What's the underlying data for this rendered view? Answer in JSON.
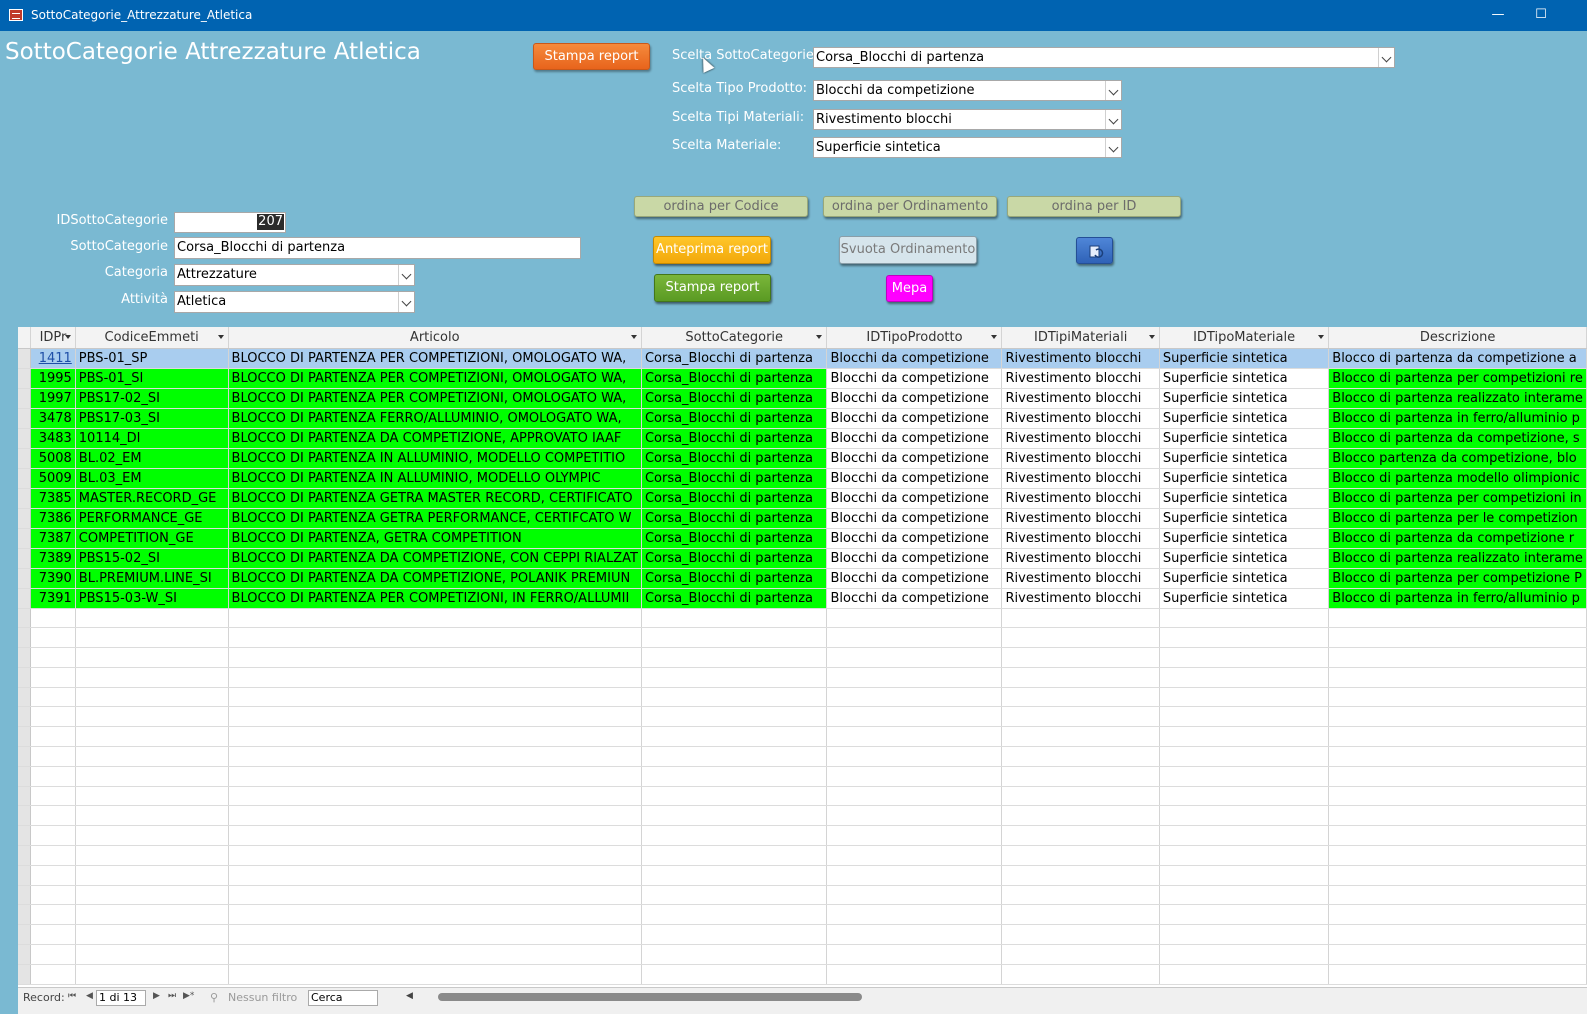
{
  "window": {
    "title": "SottoCategorie_Attrezzature_Atletica",
    "minimize": "—",
    "maximize": "☐"
  },
  "form_title": "SottoCategorie Attrezzature Atletica",
  "buttons": {
    "stampa_report_top": "Stampa report",
    "ordina_codice": "ordina per Codice",
    "ordina_ordinamento": "ordina per Ordinamento",
    "ordina_id": "ordina per ID",
    "anteprima_report": "Anteprima report",
    "svuota_ordinamento": "Svuota Ordinamento",
    "stampa_report": "Stampa report",
    "mepa": "Mepa"
  },
  "filters": {
    "sottocategorie_label": "Scelta SottoCategorie:",
    "sottocategorie_value": "Corsa_Blocchi di partenza",
    "tipo_prodotto_label": "Scelta Tipo Prodotto:",
    "tipo_prodotto_value": "Blocchi da competizione",
    "tipi_materiali_label": "Scelta Tipi Materiali:",
    "tipi_materiali_value": "Rivestimento blocchi",
    "materiale_label": "Scelta Materiale:",
    "materiale_value": "Superficie sintetica"
  },
  "record": {
    "id_label": "IDSottoCategorie",
    "id_value": "207",
    "sotto_label": "SottoCategorie",
    "sotto_value": "Corsa_Blocchi di partenza",
    "categoria_label": "Categoria",
    "categoria_value": "Attrezzature",
    "attivita_label": "Attività",
    "attivita_value": "Atletica"
  },
  "grid": {
    "columns": [
      "IDPr",
      "CodiceEmmeti",
      "Articolo",
      "SottoCategorie",
      "IDTipoProdotto",
      "IDTipiMateriali",
      "IDTipoMateriale",
      "Descrizione"
    ],
    "rows": [
      [
        "1411",
        "PBS-01_SP",
        "BLOCCO DI PARTENZA PER COMPETIZIONI, OMOLOGATO WA,",
        "Corsa_Blocchi di partenza",
        "Blocchi da competizione",
        "Rivestimento blocchi",
        "Superficie sintetica",
        "Blocco di partenza da competizione a"
      ],
      [
        "1995",
        "PBS-01_SI",
        "BLOCCO DI PARTENZA PER COMPETIZIONI, OMOLOGATO WA,",
        "Corsa_Blocchi di partenza",
        "Blocchi da competizione",
        "Rivestimento blocchi",
        "Superficie sintetica",
        "Blocco di partenza per competizioni re"
      ],
      [
        "1997",
        "PBS17-02_SI",
        "BLOCCO DI PARTENZA PER COMPETIZIONI, OMOLOGATO WA,",
        "Corsa_Blocchi di partenza",
        "Blocchi da competizione",
        "Rivestimento blocchi",
        "Superficie sintetica",
        "Blocco di partenza realizzato interame"
      ],
      [
        "3478",
        "PBS17-03_SI",
        "BLOCCO DI PARTENZA FERRO/ALLUMINIO, OMOLOGATO WA,",
        "Corsa_Blocchi di partenza",
        "Blocchi da competizione",
        "Rivestimento blocchi",
        "Superficie sintetica",
        "Blocco di partenza in ferro/alluminio p"
      ],
      [
        "3483",
        "10114_DI",
        "BLOCCO DI PARTENZA DA COMPETIZIONE, APPROVATO IAAF",
        "Corsa_Blocchi di partenza",
        "Blocchi da competizione",
        "Rivestimento blocchi",
        "Superficie sintetica",
        "Blocco di partenza da competizione, s"
      ],
      [
        "5008",
        "BL.02_EM",
        "BLOCCO DI PARTENZA IN ALLUMINIO, MODELLO COMPETITIO",
        "Corsa_Blocchi di partenza",
        "Blocchi da competizione",
        "Rivestimento blocchi",
        "Superficie sintetica",
        "Blocco partenza da competizione, blo"
      ],
      [
        "5009",
        "BL.03_EM",
        "BLOCCO DI PARTENZA IN ALLUMINIO, MODELLO OLYMPIC",
        "Corsa_Blocchi di partenza",
        "Blocchi da competizione",
        "Rivestimento blocchi",
        "Superficie sintetica",
        "Blocco di partenza modello olimpionic"
      ],
      [
        "7385",
        "MASTER.RECORD_GE",
        "BLOCCO DI PARTENZA GETRA MASTER RECORD, CERTIFICATO",
        "Corsa_Blocchi di partenza",
        "Blocchi da competizione",
        "Rivestimento blocchi",
        "Superficie sintetica",
        "Blocco di partenza per competizioni in"
      ],
      [
        "7386",
        "PERFORMANCE_GE",
        "BLOCCO DI PARTENZA GETRA PERFORMANCE, CERTIFCATO W",
        "Corsa_Blocchi di partenza",
        "Blocchi da competizione",
        "Rivestimento blocchi",
        "Superficie sintetica",
        "Blocco di partenza per le competizion"
      ],
      [
        "7387",
        "COMPETITION_GE",
        "BLOCCO DI PARTENZA, GETRA COMPETITION",
        "Corsa_Blocchi di partenza",
        "Blocchi da competizione",
        "Rivestimento blocchi",
        "Superficie sintetica",
        "Blocco di partenza da competizione r"
      ],
      [
        "7389",
        "PBS15-02_SI",
        "BLOCCO DI PARTENZA DA COMPETIZIONE, CON CEPPI RIALZAT",
        "Corsa_Blocchi di partenza",
        "Blocchi da competizione",
        "Rivestimento blocchi",
        "Superficie sintetica",
        "Blocco di partenza realizzato interame"
      ],
      [
        "7390",
        "BL.PREMIUM.LINE_SI",
        "BLOCCO DI PARTENZA DA COMPETIZIONE, POLANIK PREMIUN",
        "Corsa_Blocchi di partenza",
        "Blocchi da competizione",
        "Rivestimento blocchi",
        "Superficie sintetica",
        "Blocco di partenza per competizione P"
      ],
      [
        "7391",
        "PBS15-03-W_SI",
        "BLOCCO DI PARTENZA PER COMPETIZIONI, IN FERRO/ALLUMII",
        "Corsa_Blocchi di partenza",
        "Blocchi da competizione",
        "Rivestimento blocchi",
        "Superficie sintetica",
        "Blocco di partenza in ferro/alluminio p"
      ]
    ]
  },
  "navbar": {
    "record_label": "Record:",
    "position": "1 di 13",
    "filter": "Nessun filtro",
    "search": "Cerca"
  },
  "colors": {
    "form_bg": "#7ab9d2",
    "highlight": "#00ff00",
    "selected_row": "#a9cdef",
    "titlebar": "#0063b1"
  }
}
